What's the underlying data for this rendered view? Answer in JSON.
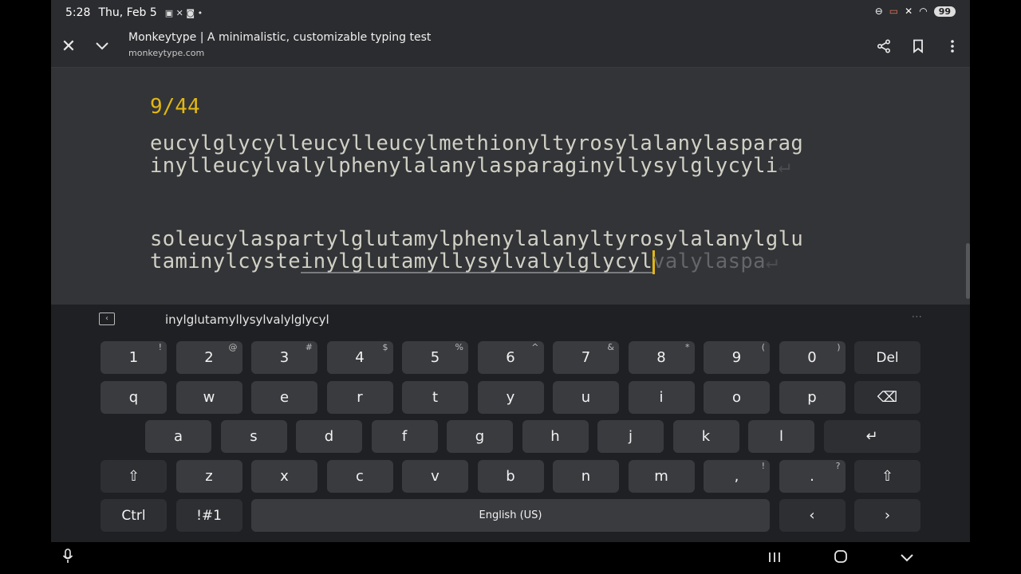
{
  "status_bar": {
    "time": "5:28",
    "date": "Thu, Feb 5",
    "battery": "99"
  },
  "browser": {
    "page_title": "Monkeytype | A minimalistic, customizable typing test",
    "url": "monkeytype.com"
  },
  "typing_test": {
    "counter": "9/44",
    "line1": "eucylglycylleucylleucylmethionyltyrosylalanylasparag",
    "line2": "inylleucylvalylphenylalanylasparaginyllysylglycyli",
    "line3": "soleucylaspartylglutamylphenylalanyltyrosylalanylglu",
    "line4_typed": "taminylcyste",
    "line4_current": "inylglutamyllysylvalylglycyl",
    "line4_remaining": "valylaspa",
    "enter_symbol": "↵",
    "colors": {
      "accent": "#e2b714",
      "text": "#d1d0c5",
      "sub": "#646669",
      "bg": "#323437"
    }
  },
  "suggestion_bar": {
    "suggestion": "inylglutamyllysylvalylglycyl",
    "more": "···"
  },
  "keyboard": {
    "rows": [
      [
        {
          "l": "1",
          "s": "!"
        },
        {
          "l": "2",
          "s": "@"
        },
        {
          "l": "3",
          "s": "#"
        },
        {
          "l": "4",
          "s": "$"
        },
        {
          "l": "5",
          "s": "%"
        },
        {
          "l": "6",
          "s": "^"
        },
        {
          "l": "7",
          "s": "&"
        },
        {
          "l": "8",
          "s": "*"
        },
        {
          "l": "9",
          "s": "("
        },
        {
          "l": "0",
          "s": ")"
        },
        {
          "l": "Del",
          "s": ""
        }
      ],
      [
        {
          "l": "q",
          "s": ""
        },
        {
          "l": "w",
          "s": ""
        },
        {
          "l": "e",
          "s": ""
        },
        {
          "l": "r",
          "s": ""
        },
        {
          "l": "t",
          "s": ""
        },
        {
          "l": "y",
          "s": ""
        },
        {
          "l": "u",
          "s": ""
        },
        {
          "l": "i",
          "s": ""
        },
        {
          "l": "o",
          "s": ""
        },
        {
          "l": "p",
          "s": ""
        },
        {
          "l": "⌫",
          "s": ""
        }
      ],
      [
        {
          "l": "a",
          "s": ""
        },
        {
          "l": "s",
          "s": ""
        },
        {
          "l": "d",
          "s": ""
        },
        {
          "l": "f",
          "s": ""
        },
        {
          "l": "g",
          "s": ""
        },
        {
          "l": "h",
          "s": ""
        },
        {
          "l": "j",
          "s": ""
        },
        {
          "l": "k",
          "s": ""
        },
        {
          "l": "l",
          "s": ""
        },
        {
          "l": "↵",
          "s": ""
        }
      ],
      [
        {
          "l": "⇧",
          "s": ""
        },
        {
          "l": "z",
          "s": ""
        },
        {
          "l": "x",
          "s": ""
        },
        {
          "l": "c",
          "s": ""
        },
        {
          "l": "v",
          "s": ""
        },
        {
          "l": "b",
          "s": ""
        },
        {
          "l": "n",
          "s": ""
        },
        {
          "l": "m",
          "s": ""
        },
        {
          "l": ",",
          "s": "!"
        },
        {
          "l": ".",
          "s": "?"
        },
        {
          "l": "⇧",
          "s": ""
        }
      ],
      [
        {
          "l": "Ctrl",
          "s": ""
        },
        {
          "l": "!#1",
          "s": ""
        },
        {
          "l": "English (US)",
          "s": ""
        },
        {
          "l": "‹",
          "s": ""
        },
        {
          "l": "›",
          "s": ""
        }
      ]
    ]
  },
  "icons": {
    "close": "close-icon",
    "collapse": "chevron-down-icon",
    "share": "share-icon",
    "bookmark": "bookmark-icon",
    "menu": "more-vert-icon",
    "mic": "mic-icon"
  }
}
